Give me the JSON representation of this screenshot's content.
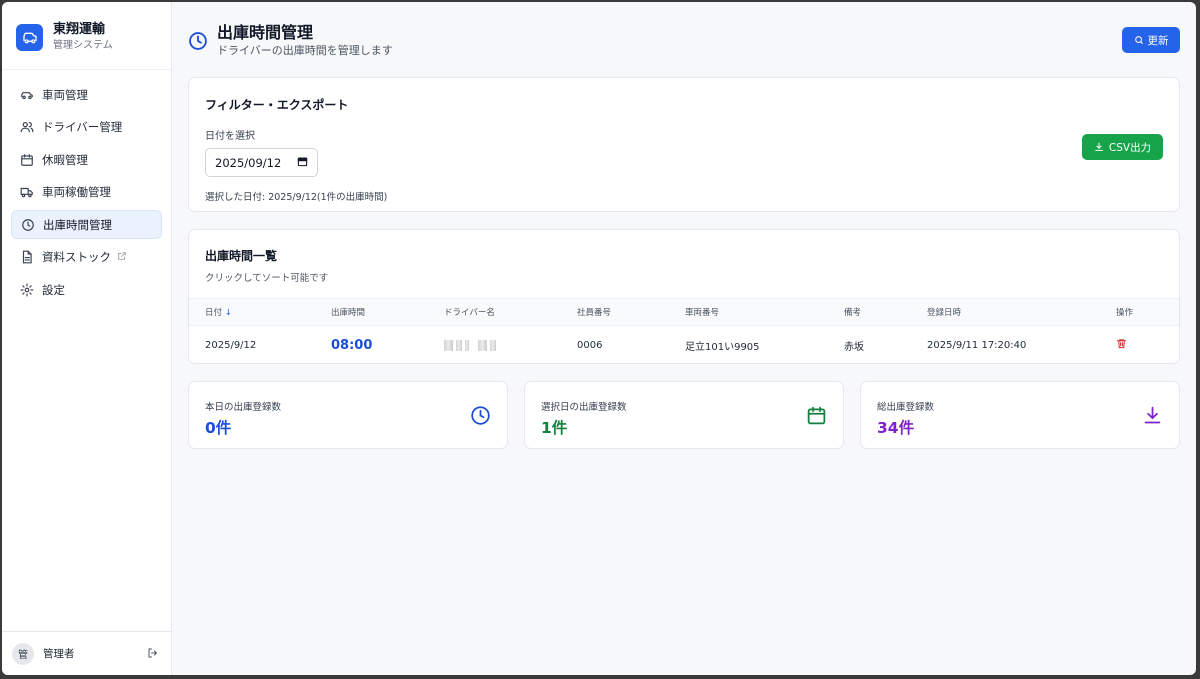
{
  "brand": {
    "name": "東翔運輸",
    "sub": "管理システム"
  },
  "nav": [
    {
      "label": "車両管理",
      "icon": "car-icon"
    },
    {
      "label": "ドライバー管理",
      "icon": "users-icon"
    },
    {
      "label": "休暇管理",
      "icon": "calendar-icon"
    },
    {
      "label": "車両稼働管理",
      "icon": "truck-icon"
    },
    {
      "label": "出庫時間管理",
      "icon": "clock-icon",
      "active": true
    },
    {
      "label": "資料ストック",
      "icon": "file-icon",
      "external": true
    },
    {
      "label": "設定",
      "icon": "gear-icon"
    }
  ],
  "user": {
    "avatar": "管",
    "name": "管理者"
  },
  "header": {
    "title": "出庫時間管理",
    "subtitle": "ドライバーの出庫時間を管理します",
    "refresh_label": "更新"
  },
  "filter": {
    "title": "フィルター・エクスポート",
    "date_label": "日付を選択",
    "date_value": "2025/09/12",
    "selected_info": "選択した日付: 2025/9/12(1件の出庫時間)",
    "csv_label": "CSV出力"
  },
  "list": {
    "title": "出庫時間一覧",
    "subtitle": "クリックしてソート可能です",
    "columns": [
      "日付",
      "出庫時間",
      "ドライバー名",
      "社員番号",
      "車両番号",
      "備考",
      "登録日時",
      "操作"
    ],
    "sort_indicator": "↓",
    "rows": [
      {
        "date": "2025/9/12",
        "time": "08:00",
        "driver": "",
        "employee_no": "0006",
        "vehicle_no": "足立101い9905",
        "note": "赤坂",
        "registered": "2025/9/11 17:20:40"
      }
    ]
  },
  "stats": [
    {
      "label": "本日の出庫登録数",
      "value": "0件",
      "color": "#1d4ed8",
      "icon": "clock-icon"
    },
    {
      "label": "選択日の出庫登録数",
      "value": "1件",
      "color": "#15803d",
      "icon": "calendar-icon"
    },
    {
      "label": "総出庫登録数",
      "value": "34件",
      "color": "#7e22ce",
      "icon": "download-icon"
    }
  ]
}
